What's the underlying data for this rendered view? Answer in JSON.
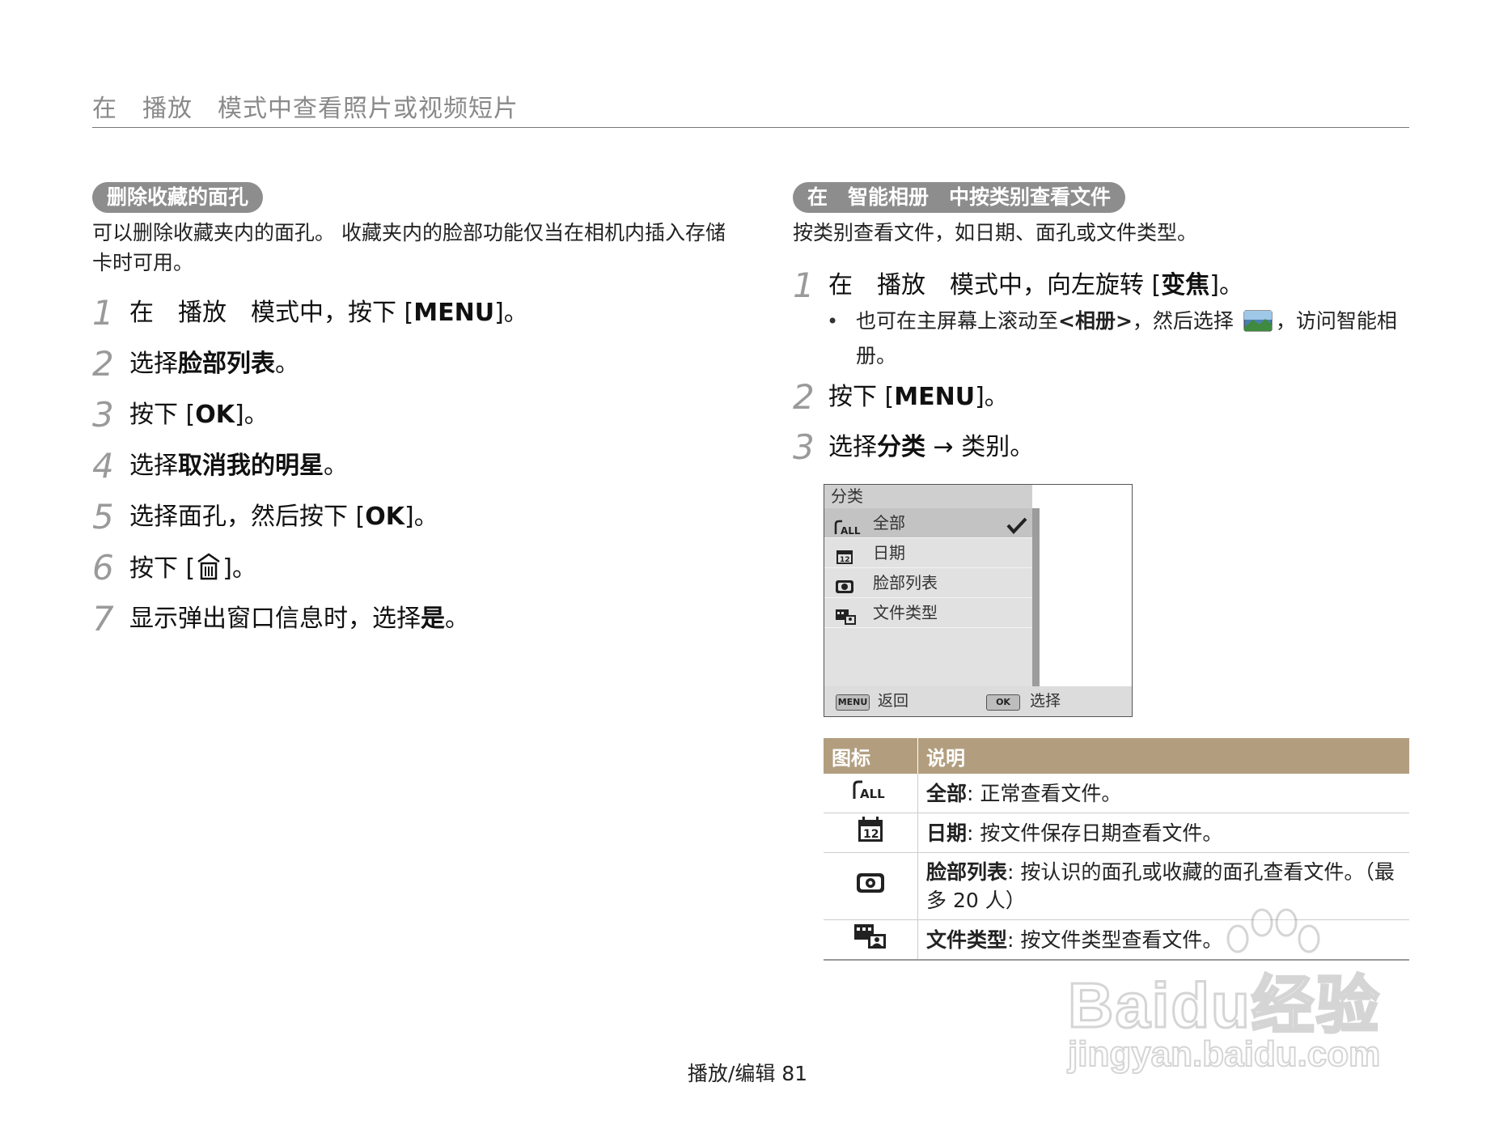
{
  "header": {
    "title": "在　播放　模式中查看照片或视频短片"
  },
  "left": {
    "section_title": "删除收藏的面孔",
    "intro": "可以删除收藏夹内的面孔。 收藏夹内的脸部功能仅当在相机内插入存储卡时可用。",
    "steps": [
      {
        "num": "1",
        "pre": "在　播放　模式中，按下 [",
        "bold": "MENU",
        "post": "]。"
      },
      {
        "num": "2",
        "pre": "选择",
        "bold": "脸部列表",
        "post": "。"
      },
      {
        "num": "3",
        "pre": "按下 [",
        "bold": "OK",
        "post": "]。"
      },
      {
        "num": "4",
        "pre": "选择",
        "bold": "取消我的明星",
        "post": "。"
      },
      {
        "num": "5",
        "pre": "选择面孔，然后按下 [",
        "bold": "OK",
        "post": "]。"
      },
      {
        "num": "6",
        "pre": "按下 [",
        "bold": "",
        "post": "]。"
      },
      {
        "num": "7",
        "pre": "显示弹出窗口信息时，选择",
        "bold": "是",
        "post": "。"
      }
    ]
  },
  "right": {
    "section_title": "在　智能相册　中按类别查看文件",
    "intro": "按类别查看文件，如日期、面孔或文件类型。",
    "step1": {
      "num": "1",
      "pre": "在　播放　模式中，向左旋转 [",
      "bold": "变焦",
      "post": "]。"
    },
    "bullet": {
      "pre": "也可在主屏幕上滚动至",
      "bold": "<相册>",
      "mid": "，然后选择",
      "post": "，访问智能相册。"
    },
    "step2": {
      "num": "2",
      "pre": "按下 [",
      "bold": "MENU",
      "post": "]。"
    },
    "step3": {
      "num": "3",
      "pre": "选择",
      "bold": "分类",
      "post": " → 类别。"
    }
  },
  "screen": {
    "title": "分类",
    "items": [
      {
        "icon": "all-icon",
        "label": "全部",
        "selected": true
      },
      {
        "icon": "calendar-icon",
        "label": "日期",
        "selected": false
      },
      {
        "icon": "face-icon",
        "label": "脸部列表",
        "selected": false
      },
      {
        "icon": "filetype-icon",
        "label": "文件类型",
        "selected": false
      }
    ],
    "back_btn": "MENU",
    "back_label": "返回",
    "ok_btn": "OK",
    "ok_label": "选择"
  },
  "table": {
    "headers": [
      "图标",
      "说明"
    ],
    "rows": [
      {
        "icon": "all-icon",
        "term": "全部",
        "desc": ": 正常查看文件。"
      },
      {
        "icon": "calendar-icon",
        "term": "日期",
        "desc": ": 按文件保存日期查看文件。"
      },
      {
        "icon": "face-icon",
        "term": "脸部列表",
        "desc": ": 按认识的面孔或收藏的面孔查看文件。（最多 20 人）"
      },
      {
        "icon": "filetype-icon",
        "term": "文件类型",
        "desc": ": 按文件类型查看文件。"
      }
    ]
  },
  "footer": {
    "text": "播放/编辑  81"
  },
  "watermark": {
    "line1": "Baidu经验",
    "line2": "jingyan.baidu.com"
  }
}
